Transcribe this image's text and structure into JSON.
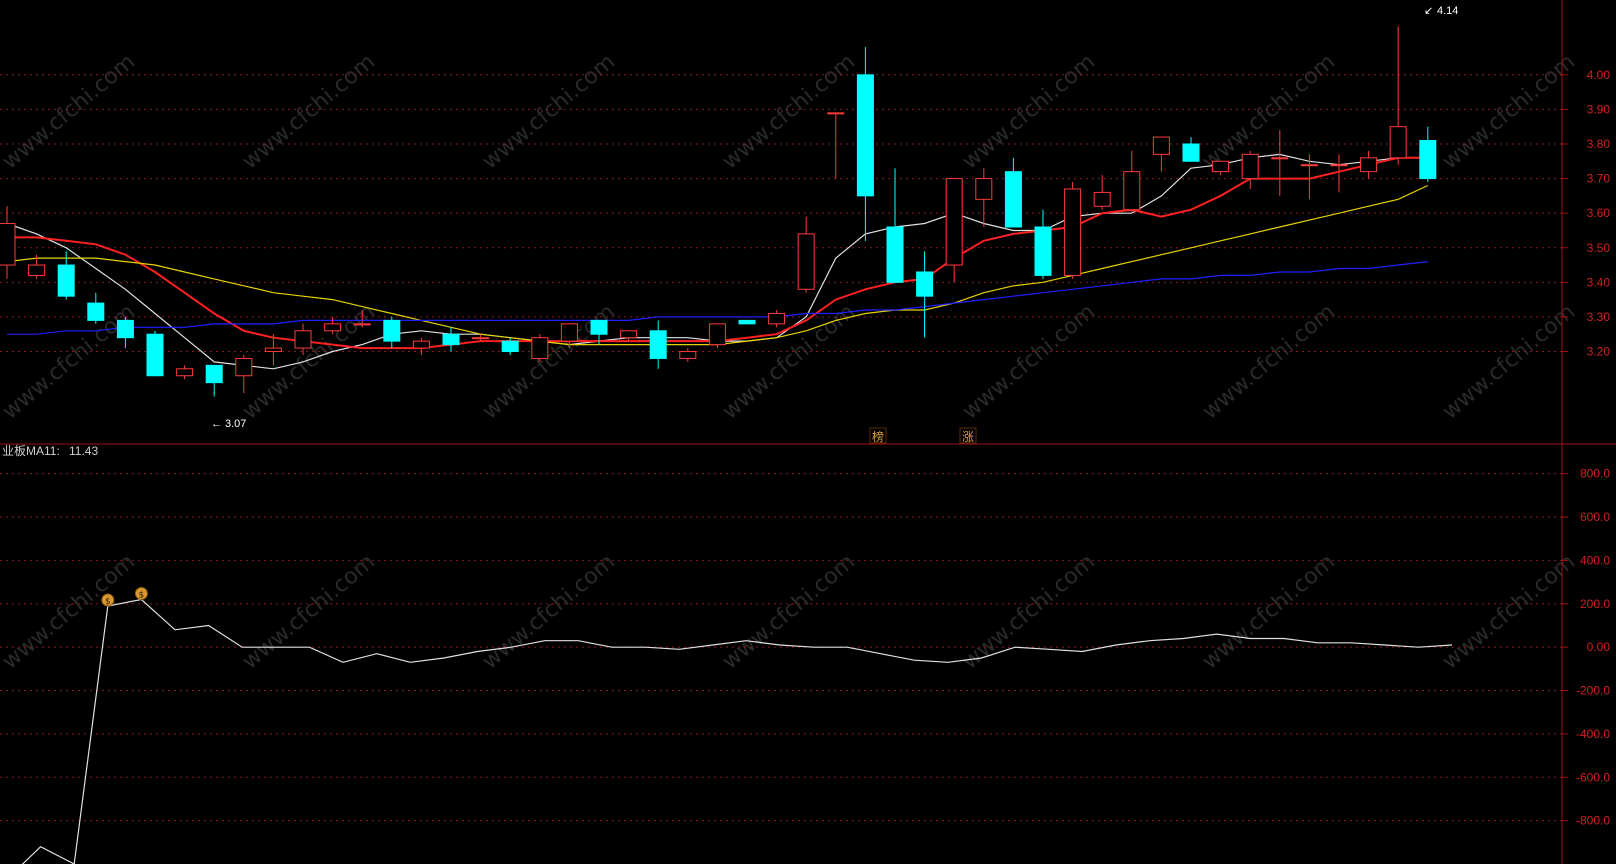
{
  "indicator_header": {
    "name_fragment": "业板",
    "ma_label": "MA11:",
    "ma_value": "11.43"
  },
  "price_annotations": {
    "low_label": "3.07",
    "high_label": "4.14"
  },
  "event_markers": [
    "榜",
    "涨"
  ],
  "watermark": "www.cfchi.com",
  "colors": {
    "up": "#ff3a3a",
    "down": "#00ffff",
    "ma_white": "#e0e0e0",
    "ma_red": "#ff2020",
    "ma_yellow": "#e6d200",
    "ma_blue": "#2020ff",
    "grid": "#8b1a1a",
    "axis_text": "#d02020",
    "border": "#a01010",
    "marker": "#e0a040"
  },
  "chart_data": [
    {
      "type": "candlestick",
      "y_ticks": [
        "4.00",
        "3.90",
        "3.80",
        "3.70",
        "3.60",
        "3.50",
        "3.40",
        "3.30",
        "3.20"
      ],
      "ylim": [
        2.95,
        4.17
      ],
      "candles": [
        {
          "o": 3.45,
          "h": 3.62,
          "l": 3.41,
          "c": 3.57
        },
        {
          "o": 3.42,
          "h": 3.48,
          "l": 3.41,
          "c": 3.45
        },
        {
          "o": 3.45,
          "h": 3.49,
          "l": 3.35,
          "c": 3.36
        },
        {
          "o": 3.34,
          "h": 3.37,
          "l": 3.28,
          "c": 3.29
        },
        {
          "o": 3.29,
          "h": 3.3,
          "l": 3.21,
          "c": 3.24
        },
        {
          "o": 3.25,
          "h": 3.26,
          "l": 3.13,
          "c": 3.13
        },
        {
          "o": 3.13,
          "h": 3.16,
          "l": 3.12,
          "c": 3.15
        },
        {
          "o": 3.16,
          "h": 3.16,
          "l": 3.07,
          "c": 3.11
        },
        {
          "o": 3.13,
          "h": 3.19,
          "l": 3.08,
          "c": 3.18
        },
        {
          "o": 3.2,
          "h": 3.25,
          "l": 3.16,
          "c": 3.21
        },
        {
          "o": 3.21,
          "h": 3.28,
          "l": 3.19,
          "c": 3.26
        },
        {
          "o": 3.26,
          "h": 3.3,
          "l": 3.25,
          "c": 3.28
        },
        {
          "o": 3.28,
          "h": 3.32,
          "l": 3.27,
          "c": 3.28
        },
        {
          "o": 3.29,
          "h": 3.3,
          "l": 3.21,
          "c": 3.23
        },
        {
          "o": 3.21,
          "h": 3.24,
          "l": 3.19,
          "c": 3.23
        },
        {
          "o": 3.25,
          "h": 3.27,
          "l": 3.2,
          "c": 3.22
        },
        {
          "o": 3.24,
          "h": 3.25,
          "l": 3.23,
          "c": 3.24
        },
        {
          "o": 3.23,
          "h": 3.24,
          "l": 3.19,
          "c": 3.2
        },
        {
          "o": 3.18,
          "h": 3.25,
          "l": 3.17,
          "c": 3.24
        },
        {
          "o": 3.23,
          "h": 3.28,
          "l": 3.21,
          "c": 3.28
        },
        {
          "o": 3.29,
          "h": 3.29,
          "l": 3.22,
          "c": 3.25
        },
        {
          "o": 3.24,
          "h": 3.26,
          "l": 3.23,
          "c": 3.26
        },
        {
          "o": 3.26,
          "h": 3.29,
          "l": 3.15,
          "c": 3.18
        },
        {
          "o": 3.18,
          "h": 3.21,
          "l": 3.17,
          "c": 3.2
        },
        {
          "o": 3.22,
          "h": 3.28,
          "l": 3.21,
          "c": 3.28
        },
        {
          "o": 3.29,
          "h": 3.29,
          "l": 3.28,
          "c": 3.28
        },
        {
          "o": 3.28,
          "h": 3.32,
          "l": 3.27,
          "c": 3.31
        },
        {
          "o": 3.38,
          "h": 3.59,
          "l": 3.37,
          "c": 3.54
        },
        {
          "o": 3.89,
          "h": 3.89,
          "l": 3.7,
          "c": 3.89
        },
        {
          "o": 4.0,
          "h": 4.08,
          "l": 3.52,
          "c": 3.65
        },
        {
          "o": 3.56,
          "h": 3.73,
          "l": 3.4,
          "c": 3.4
        },
        {
          "o": 3.43,
          "h": 3.49,
          "l": 3.24,
          "c": 3.36
        },
        {
          "o": 3.45,
          "h": 3.7,
          "l": 3.4,
          "c": 3.7
        },
        {
          "o": 3.64,
          "h": 3.73,
          "l": 3.56,
          "c": 3.7
        },
        {
          "o": 3.72,
          "h": 3.76,
          "l": 3.56,
          "c": 3.56
        },
        {
          "o": 3.56,
          "h": 3.61,
          "l": 3.41,
          "c": 3.42
        },
        {
          "o": 3.42,
          "h": 3.69,
          "l": 3.41,
          "c": 3.67
        },
        {
          "o": 3.62,
          "h": 3.71,
          "l": 3.61,
          "c": 3.66
        },
        {
          "o": 3.61,
          "h": 3.78,
          "l": 3.6,
          "c": 3.72
        },
        {
          "o": 3.77,
          "h": 3.82,
          "l": 3.72,
          "c": 3.82
        },
        {
          "o": 3.8,
          "h": 3.82,
          "l": 3.75,
          "c": 3.75
        },
        {
          "o": 3.72,
          "h": 3.75,
          "l": 3.71,
          "c": 3.75
        },
        {
          "o": 3.7,
          "h": 3.78,
          "l": 3.67,
          "c": 3.77
        },
        {
          "o": 3.76,
          "h": 3.84,
          "l": 3.65,
          "c": 3.76
        },
        {
          "o": 3.74,
          "h": 3.77,
          "l": 3.64,
          "c": 3.74
        },
        {
          "o": 3.74,
          "h": 3.77,
          "l": 3.66,
          "c": 3.74
        },
        {
          "o": 3.72,
          "h": 3.78,
          "l": 3.7,
          "c": 3.76
        },
        {
          "o": 3.76,
          "h": 4.14,
          "l": 3.74,
          "c": 3.85
        },
        {
          "o": 3.81,
          "h": 3.85,
          "l": 3.69,
          "c": 3.7
        }
      ],
      "ma_series": [
        {
          "color_key": "ma_white",
          "values": [
            3.57,
            3.54,
            3.5,
            3.44,
            3.38,
            3.31,
            3.24,
            3.17,
            3.16,
            3.15,
            3.17,
            3.2,
            3.22,
            3.25,
            3.26,
            3.25,
            3.25,
            3.24,
            3.23,
            3.22,
            3.23,
            3.24,
            3.24,
            3.24,
            3.23,
            3.23,
            3.24,
            3.3,
            3.47,
            3.54,
            3.56,
            3.57,
            3.6,
            3.57,
            3.55,
            3.55,
            3.59,
            3.6,
            3.6,
            3.65,
            3.73,
            3.74,
            3.76,
            3.77,
            3.75,
            3.74,
            3.75,
            3.76,
            3.76
          ]
        },
        {
          "color_key": "ma_red",
          "values": [
            3.53,
            3.53,
            3.52,
            3.51,
            3.48,
            3.43,
            3.37,
            3.31,
            3.26,
            3.24,
            3.23,
            3.22,
            3.21,
            3.21,
            3.21,
            3.22,
            3.23,
            3.23,
            3.23,
            3.23,
            3.23,
            3.23,
            3.23,
            3.23,
            3.23,
            3.24,
            3.25,
            3.29,
            3.35,
            3.38,
            3.4,
            3.41,
            3.47,
            3.52,
            3.54,
            3.55,
            3.56,
            3.6,
            3.61,
            3.59,
            3.61,
            3.65,
            3.7,
            3.7,
            3.7,
            3.72,
            3.74,
            3.76,
            3.76
          ]
        },
        {
          "color_key": "ma_yellow",
          "values": [
            3.46,
            3.47,
            3.47,
            3.47,
            3.46,
            3.45,
            3.43,
            3.41,
            3.39,
            3.37,
            3.36,
            3.35,
            3.33,
            3.31,
            3.29,
            3.27,
            3.25,
            3.24,
            3.23,
            3.22,
            3.22,
            3.22,
            3.22,
            3.22,
            3.22,
            3.23,
            3.24,
            3.26,
            3.29,
            3.31,
            3.32,
            3.32,
            3.34,
            3.37,
            3.39,
            3.4,
            3.42,
            3.44,
            3.46,
            3.48,
            3.5,
            3.52,
            3.54,
            3.56,
            3.58,
            3.6,
            3.62,
            3.64,
            3.68
          ]
        },
        {
          "color_key": "ma_blue",
          "values": [
            3.25,
            3.25,
            3.26,
            3.26,
            3.27,
            3.27,
            3.27,
            3.28,
            3.28,
            3.28,
            3.29,
            3.29,
            3.29,
            3.29,
            3.29,
            3.29,
            3.29,
            3.29,
            3.29,
            3.29,
            3.29,
            3.29,
            3.3,
            3.3,
            3.3,
            3.3,
            3.3,
            3.31,
            3.31,
            3.32,
            3.32,
            3.33,
            3.34,
            3.35,
            3.36,
            3.37,
            3.38,
            3.39,
            3.4,
            3.41,
            3.41,
            3.42,
            3.42,
            3.43,
            3.43,
            3.44,
            3.44,
            3.45,
            3.46
          ]
        }
      ]
    },
    {
      "type": "line",
      "y_ticks": [
        "800.0",
        "600.0",
        "400.0",
        "200.0",
        "0.00",
        "-200.0",
        "-400.0",
        "-600.0",
        "-800.0"
      ],
      "ylim": [
        -1000,
        900
      ],
      "values": [
        -1070,
        -920,
        -1000,
        190,
        220,
        80,
        100,
        0,
        0,
        0,
        -70,
        -30,
        -70,
        -50,
        -20,
        0,
        30,
        30,
        0,
        0,
        -10,
        10,
        30,
        10,
        0,
        0,
        -30,
        -60,
        -70,
        -50,
        0,
        -10,
        -20,
        10,
        30,
        40,
        60,
        40,
        40,
        20,
        20,
        10,
        0,
        10
      ]
    }
  ]
}
